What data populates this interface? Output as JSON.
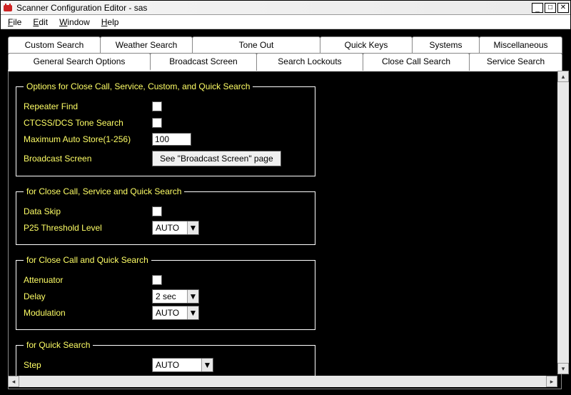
{
  "window": {
    "title": "Scanner Configuration Editor - sas"
  },
  "menus": {
    "file": "File",
    "edit": "Edit",
    "window": "Window",
    "help": "Help"
  },
  "tabs": {
    "row1": {
      "custom_search": "Custom Search",
      "weather_search": "Weather Search",
      "tone_out": "Tone Out",
      "quick_keys": "Quick Keys",
      "systems": "Systems",
      "miscellaneous": "Miscellaneous"
    },
    "row2": {
      "general_search_options": "General Search Options",
      "broadcast_screen": "Broadcast Screen",
      "search_lockouts": "Search Lockouts",
      "close_call_search": "Close Call Search",
      "service_search": "Service Search"
    },
    "active": "general_search_options"
  },
  "group1": {
    "legend": "Options for Close Call, Service, Custom, and Quick Search",
    "repeater_find": {
      "label": "Repeater Find",
      "checked": false
    },
    "ctcss_dcs": {
      "label": "CTCSS/DCS Tone Search",
      "checked": false
    },
    "max_auto_store": {
      "label": "Maximum Auto Store(1-256)",
      "value": "100"
    },
    "broadcast_screen_label": "Broadcast Screen",
    "broadcast_button": "See \"Broadcast Screen\" page"
  },
  "group2": {
    "legend": "for Close Call, Service and Quick Search",
    "data_skip": {
      "label": "Data Skip",
      "checked": false
    },
    "p25_threshold": {
      "label": "P25 Threshold Level",
      "value": "AUTO"
    }
  },
  "group3": {
    "legend": "for Close Call and Quick Search",
    "attenuator": {
      "label": "Attenuator",
      "checked": false
    },
    "delay": {
      "label": "Delay",
      "value": "2 sec"
    },
    "modulation": {
      "label": "Modulation",
      "value": "AUTO"
    }
  },
  "group4": {
    "legend": "for Quick Search",
    "step": {
      "label": "Step",
      "value": "AUTO"
    }
  },
  "icons": {
    "minimize": "_",
    "maximize": "□",
    "close": "✕",
    "dropdown": "▼",
    "up": "▲",
    "down": "▼",
    "left": "◀",
    "right": "▶"
  }
}
